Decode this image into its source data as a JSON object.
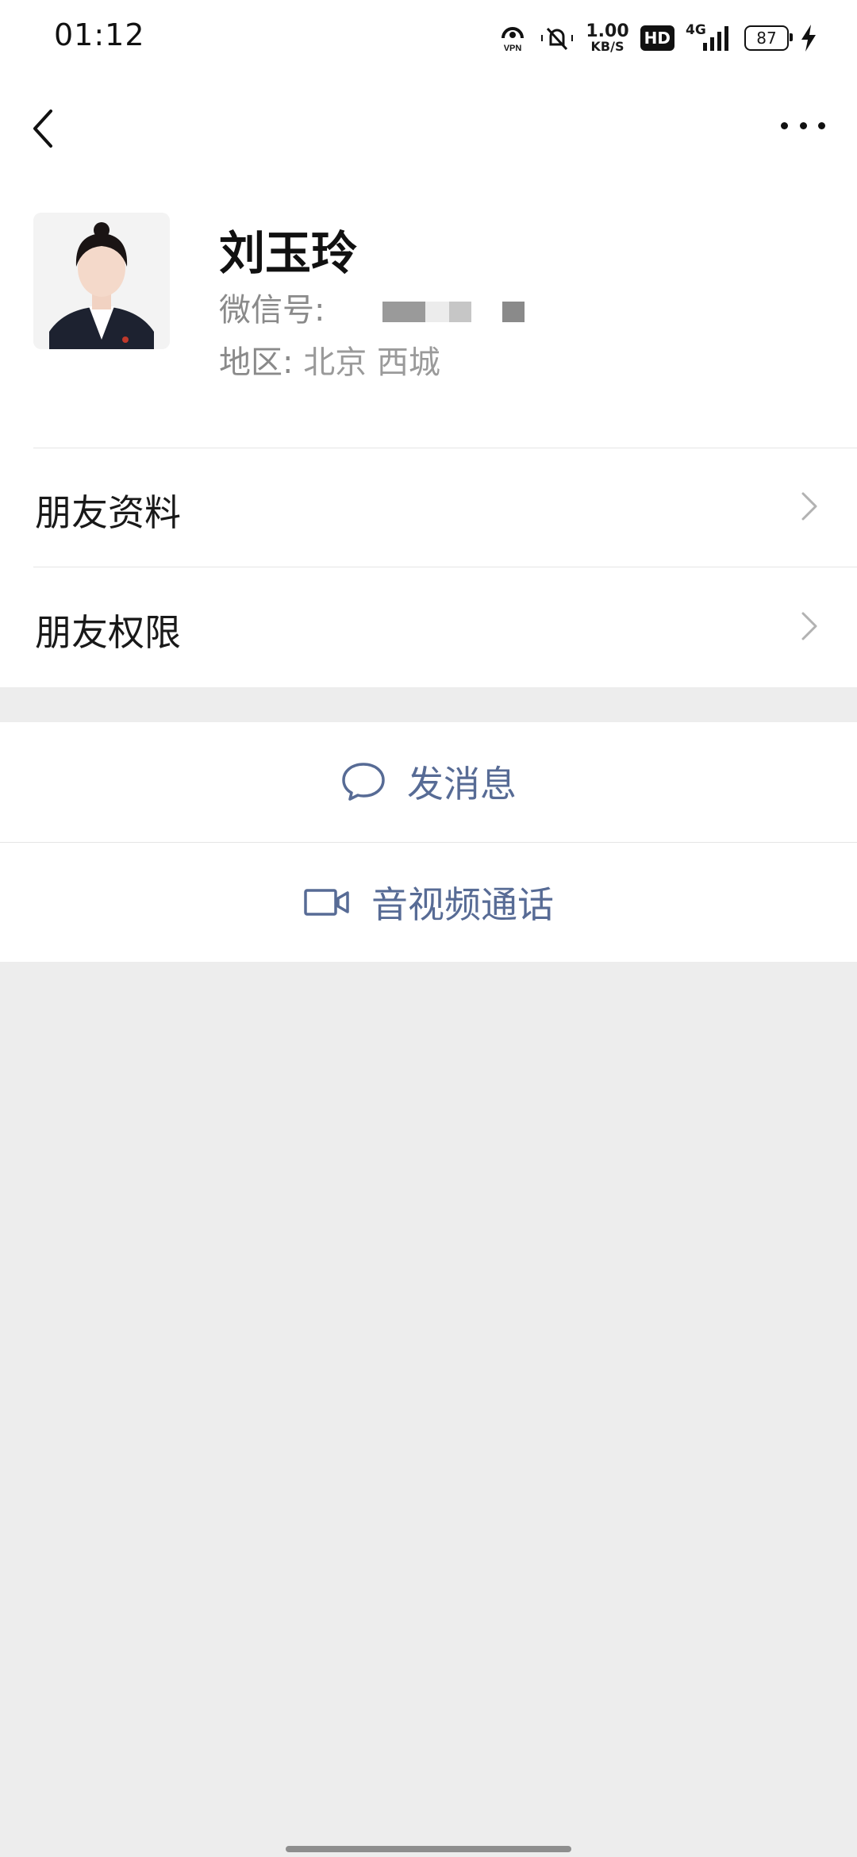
{
  "status_bar": {
    "time": "01:12",
    "vpn": "VPN",
    "net_speed_value": "1.00",
    "net_speed_unit": "KB/S",
    "hd": "HD",
    "network": "4G",
    "battery": "87",
    "icons": [
      "vpn-icon",
      "silent-bell-icon",
      "signal-icon",
      "charging-icon"
    ]
  },
  "nav": {
    "back_icon": "chevron-left-icon",
    "more_icon": "more-dots-icon"
  },
  "profile": {
    "name": "刘玉玲",
    "wechat_id_label": "微信号:",
    "region_label": "地区:",
    "region_value": "北京 西城"
  },
  "list": {
    "items": [
      {
        "label": "朋友资料"
      },
      {
        "label": "朋友权限"
      }
    ]
  },
  "actions": {
    "send_message": "发消息",
    "video_call": "音视频通话"
  },
  "colors": {
    "link_blue": "#576b95",
    "background": "#ededed"
  }
}
